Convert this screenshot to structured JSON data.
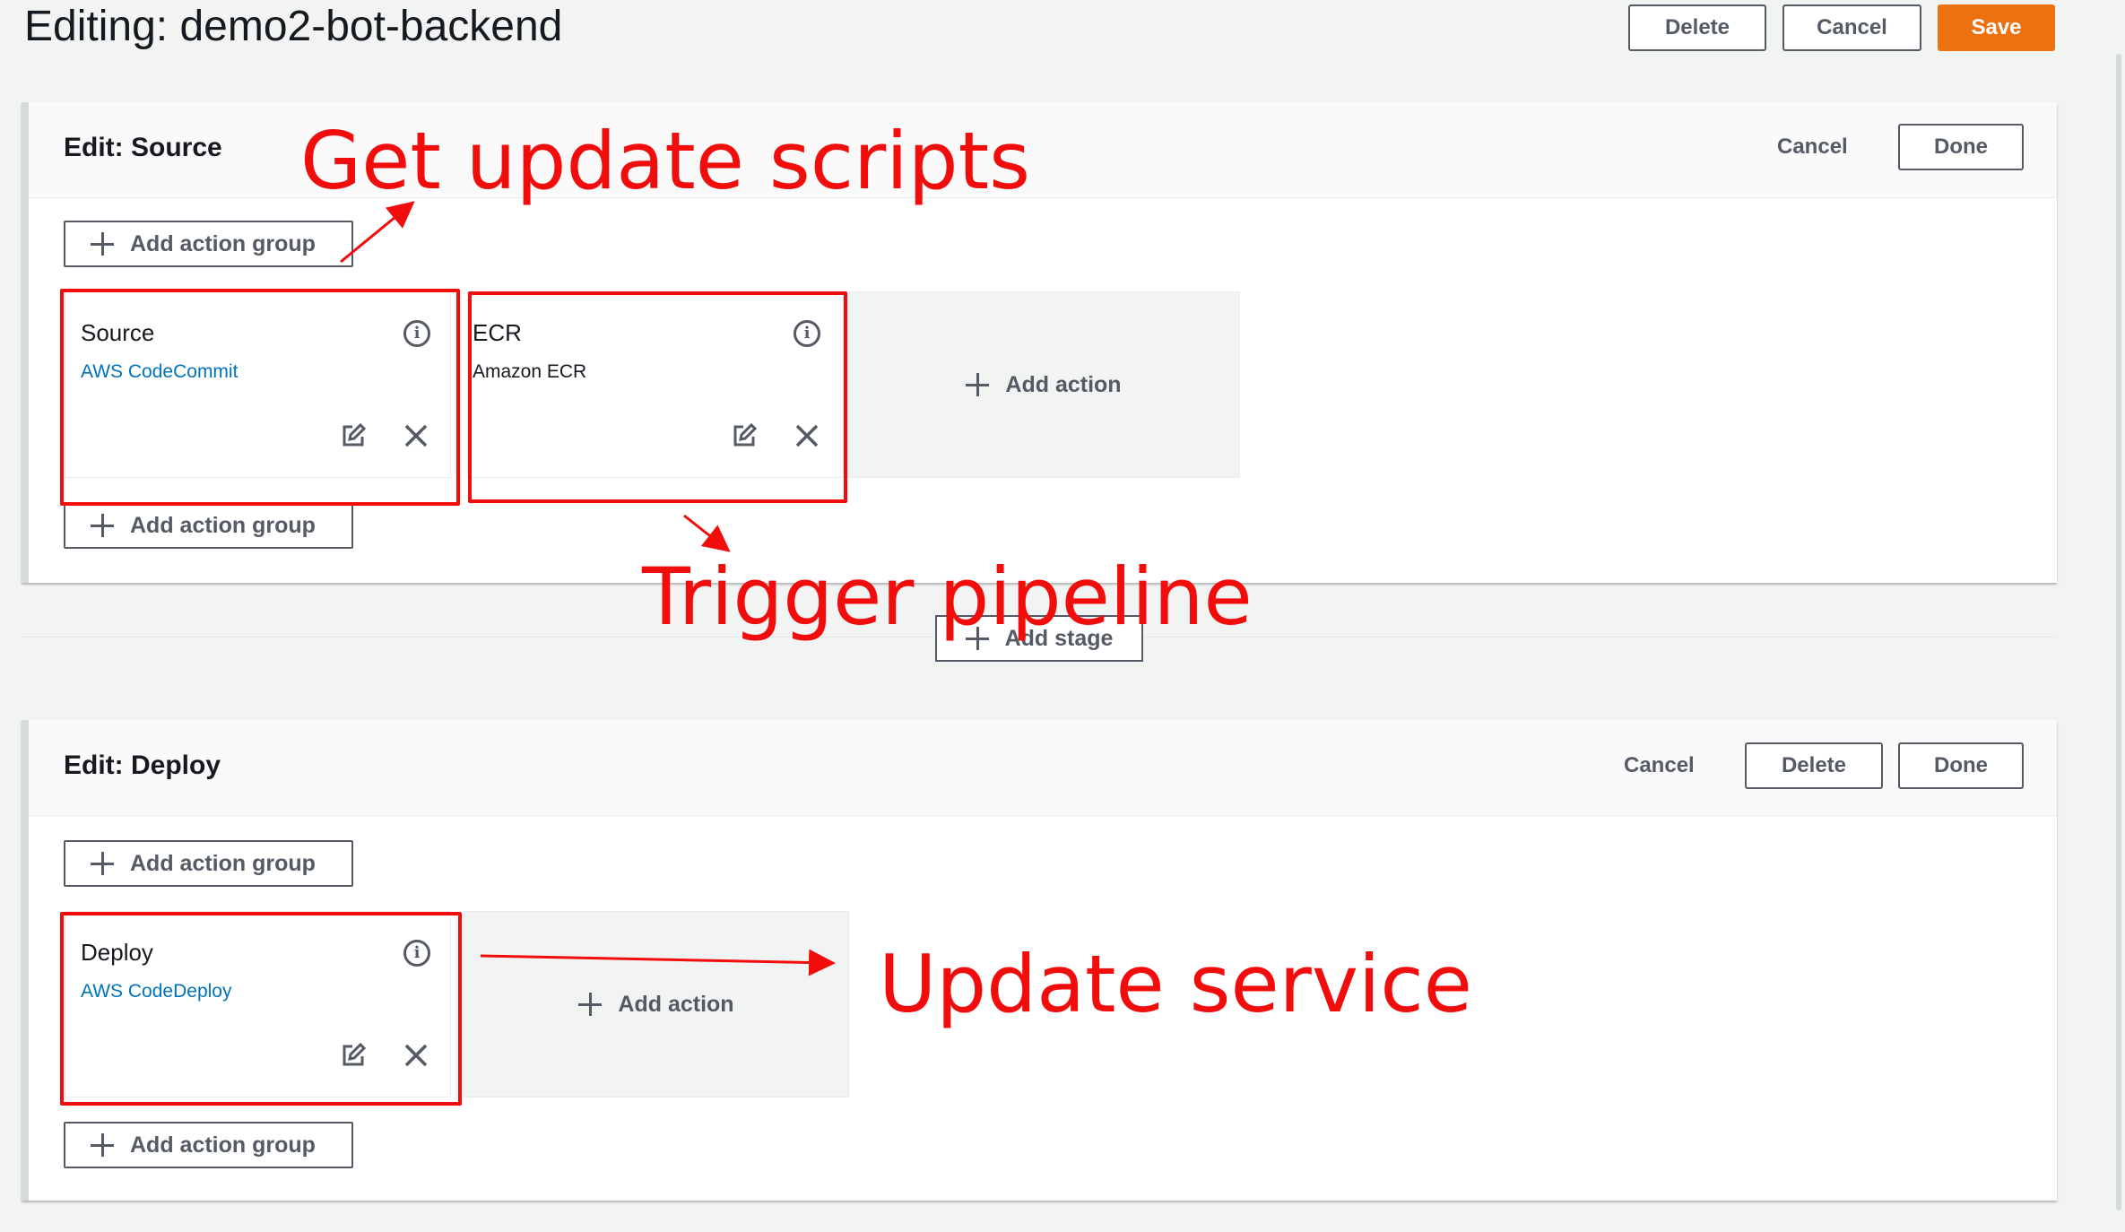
{
  "header": {
    "title": "Editing: demo2-bot-backend",
    "buttons": {
      "delete": "Delete",
      "cancel": "Cancel",
      "save": "Save"
    }
  },
  "stages": [
    {
      "title": "Edit: Source",
      "cancel": "Cancel",
      "done": "Done",
      "add_action_group": "Add action group",
      "actions": [
        {
          "name": "Source",
          "provider": "AWS CodeCommit"
        },
        {
          "name": "ECR",
          "provider": "Amazon ECR"
        }
      ],
      "add_action": "Add action"
    },
    {
      "title": "Edit: Deploy",
      "cancel": "Cancel",
      "delete": "Delete",
      "done": "Done",
      "add_action_group": "Add action group",
      "actions": [
        {
          "name": "Deploy",
          "provider": "AWS CodeDeploy"
        }
      ],
      "add_action": "Add action"
    }
  ],
  "add_stage": "Add stage",
  "annotations": {
    "get_update_scripts": "Get update scripts",
    "trigger_pipeline": "Trigger pipeline",
    "update_service": "Update service"
  },
  "colors": {
    "accent_orange": "#ec7211",
    "link_blue": "#0073bb",
    "annotation_red": "#f20d0d"
  },
  "icons": [
    "plus-icon",
    "info-icon",
    "edit-icon",
    "close-icon"
  ]
}
